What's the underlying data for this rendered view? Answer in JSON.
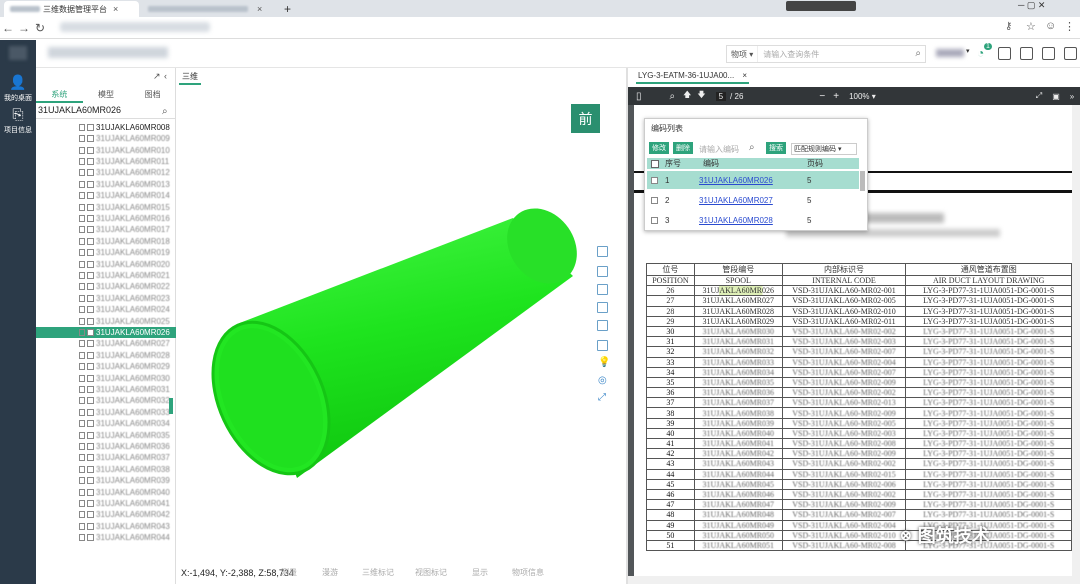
{
  "browser": {
    "tab1_title": "三维数据管理平台",
    "tab_close": "×",
    "new_tab": "+"
  },
  "header": {
    "search_scope": "物项",
    "search_placeholder": "请输入查询条件",
    "notification_count": "1"
  },
  "sidebar": {
    "items": [
      {
        "label": "我的桌面"
      },
      {
        "label": "项目信息"
      }
    ]
  },
  "tree": {
    "tabs": [
      "系统",
      "模型",
      "图档"
    ],
    "search_value": "31UJAKLA60MR026",
    "items": [
      "31UJAKLA60MR008",
      "31UJAKLA60MR009",
      "31UJAKLA60MR010",
      "31UJAKLA60MR011",
      "31UJAKLA60MR012",
      "31UJAKLA60MR013",
      "31UJAKLA60MR014",
      "31UJAKLA60MR015",
      "31UJAKLA60MR016",
      "31UJAKLA60MR017",
      "31UJAKLA60MR018",
      "31UJAKLA60MR019",
      "31UJAKLA60MR020",
      "31UJAKLA60MR021",
      "31UJAKLA60MR022",
      "31UJAKLA60MR023",
      "31UJAKLA60MR024",
      "31UJAKLA60MR025",
      "31UJAKLA60MR026",
      "31UJAKLA60MR027",
      "31UJAKLA60MR028",
      "31UJAKLA60MR029",
      "31UJAKLA60MR030",
      "31UJAKLA60MR031",
      "31UJAKLA60MR032",
      "31UJAKLA60MR033",
      "31UJAKLA60MR034",
      "31UJAKLA60MR035",
      "31UJAKLA60MR036",
      "31UJAKLA60MR037",
      "31UJAKLA60MR038",
      "31UJAKLA60MR039",
      "31UJAKLA60MR040",
      "31UJAKLA60MR041",
      "31UJAKLA60MR042",
      "31UJAKLA60MR043",
      "31UJAKLA60MR044"
    ],
    "selected_index": 18
  },
  "viewer": {
    "tab_label": "三维",
    "front_label": "前",
    "coords": "X:-1,494, Y:-2,388, Z:58,734",
    "bottom_tools": [
      "测量",
      "漫游",
      "三维标记",
      "视图标记",
      "显示",
      "物项信息"
    ],
    "pipe_color": "#17e617"
  },
  "doc": {
    "tab_label": "LYG-3-EATM-36-1UJA00...",
    "tab_close": "×",
    "page_current": "5",
    "page_total": "/ 26",
    "zoom": "100%",
    "popup": {
      "title": "编码列表",
      "btn_edit": "修改",
      "btn_delete": "删除",
      "input_placeholder": "请输入编码",
      "btn_search": "搜索",
      "match_rule": "匹配规则编码",
      "col_index": "序号",
      "col_code": "编码",
      "col_page": "页码",
      "rows": [
        {
          "index": "1",
          "code": "31UJAKLA60MR026",
          "page": "5"
        },
        {
          "index": "2",
          "code": "31UJAKLA60MR027",
          "page": "5"
        },
        {
          "index": "3",
          "code": "31UJAKLA60MR028",
          "page": "5"
        }
      ]
    },
    "table": {
      "h1": [
        "位号",
        "管段编号",
        "内部标识号",
        "通风管道布置图"
      ],
      "h2": [
        "POSITION",
        "SPOOL",
        "INTERNAL CODE",
        "AIR DUCT LAYOUT DRAWING"
      ],
      "rows": [
        [
          "26",
          "31UJAKLA60MR026",
          "VSD-31UJAKLA60-MR02-001",
          "LYG-3-PD77-31-1UJA0051-DG-0001-S"
        ],
        [
          "27",
          "31UJAKLA60MR027",
          "VSD-31UJAKLA60-MR02-005",
          "LYG-3-PD77-31-1UJA0051-DG-0001-S"
        ],
        [
          "28",
          "31UJAKLA60MR028",
          "VSD-31UJAKLA60-MR02-010",
          "LYG-3-PD77-31-1UJA0051-DG-0001-S"
        ],
        [
          "29",
          "31UJAKLA60MR029",
          "VSD-31UJAKLA60-MR02-011",
          "LYG-3-PD77-31-1UJA0051-DG-0001-S"
        ],
        [
          "30",
          "31UJAKLA60MR030",
          "VSD-31UJAKLA60-MR02-002",
          "LYG-3-PD77-31-1UJA0051-DG-0001-S"
        ],
        [
          "31",
          "31UJAKLA60MR031",
          "VSD-31UJAKLA60-MR02-003",
          "LYG-3-PD77-31-1UJA0051-DG-0001-S"
        ],
        [
          "32",
          "31UJAKLA60MR032",
          "VSD-31UJAKLA60-MR02-007",
          "LYG-3-PD77-31-1UJA0051-DG-0001-S"
        ],
        [
          "33",
          "31UJAKLA60MR033",
          "VSD-31UJAKLA60-MR02-004",
          "LYG-3-PD77-31-1UJA0051-DG-0001-S"
        ],
        [
          "34",
          "31UJAKLA60MR034",
          "VSD-31UJAKLA60-MR02-007",
          "LYG-3-PD77-31-1UJA0051-DG-0001-S"
        ],
        [
          "35",
          "31UJAKLA60MR035",
          "VSD-31UJAKLA60-MR02-009",
          "LYG-3-PD77-31-1UJA0051-DG-0001-S"
        ],
        [
          "36",
          "31UJAKLA60MR036",
          "VSD-31UJAKLA60-MR02-002",
          "LYG-3-PD77-31-1UJA0051-DG-0001-S"
        ],
        [
          "37",
          "31UJAKLA60MR037",
          "VSD-31UJAKLA60-MR02-013",
          "LYG-3-PD77-31-1UJA0051-DG-0001-S"
        ],
        [
          "38",
          "31UJAKLA60MR038",
          "VSD-31UJAKLA60-MR02-009",
          "LYG-3-PD77-31-1UJA0051-DG-0001-S"
        ],
        [
          "39",
          "31UJAKLA60MR039",
          "VSD-31UJAKLA60-MR02-005",
          "LYG-3-PD77-31-1UJA0051-DG-0001-S"
        ],
        [
          "40",
          "31UJAKLA60MR040",
          "VSD-31UJAKLA60-MR02-003",
          "LYG-3-PD77-31-1UJA0051-DG-0001-S"
        ],
        [
          "41",
          "31UJAKLA60MR041",
          "VSD-31UJAKLA60-MR02-008",
          "LYG-3-PD77-31-1UJA0051-DG-0001-S"
        ],
        [
          "42",
          "31UJAKLA60MR042",
          "VSD-31UJAKLA60-MR02-009",
          "LYG-3-PD77-31-1UJA0051-DG-0001-S"
        ],
        [
          "43",
          "31UJAKLA60MR043",
          "VSD-31UJAKLA60-MR02-002",
          "LYG-3-PD77-31-1UJA0051-DG-0001-S"
        ],
        [
          "44",
          "31UJAKLA60MR044",
          "VSD-31UJAKLA60-MR02-015",
          "LYG-3-PD77-31-1UJA0051-DG-0001-S"
        ],
        [
          "45",
          "31UJAKLA60MR045",
          "VSD-31UJAKLA60-MR02-006",
          "LYG-3-PD77-31-1UJA0051-DG-0001-S"
        ],
        [
          "46",
          "31UJAKLA60MR046",
          "VSD-31UJAKLA60-MR02-002",
          "LYG-3-PD77-31-1UJA0051-DG-0001-S"
        ],
        [
          "47",
          "31UJAKLA60MR047",
          "VSD-31UJAKLA60-MR02-009",
          "LYG-3-PD77-31-1UJA0051-DG-0001-S"
        ],
        [
          "48",
          "31UJAKLA60MR048",
          "VSD-31UJAKLA60-MR02-007",
          "LYG-3-PD77-31-1UJA0051-DG-0001-S"
        ],
        [
          "49",
          "31UJAKLA60MR049",
          "VSD-31UJAKLA60-MR02-004",
          "LYG-3-PD77-31-1UJA0051-DG-0001-S"
        ],
        [
          "50",
          "31UJAKLA60MR050",
          "VSD-31UJAKLA60-MR02-010",
          "LYG-3-PD77-31-1UJA0051-DG-0001-S"
        ],
        [
          "51",
          "31UJAKLA60MR051",
          "VSD-31UJAKLA60-MR02-008",
          "LYG-3-PD77-31-1UJA0051-DG-0001-S"
        ]
      ]
    },
    "watermark": "图筑技术"
  }
}
